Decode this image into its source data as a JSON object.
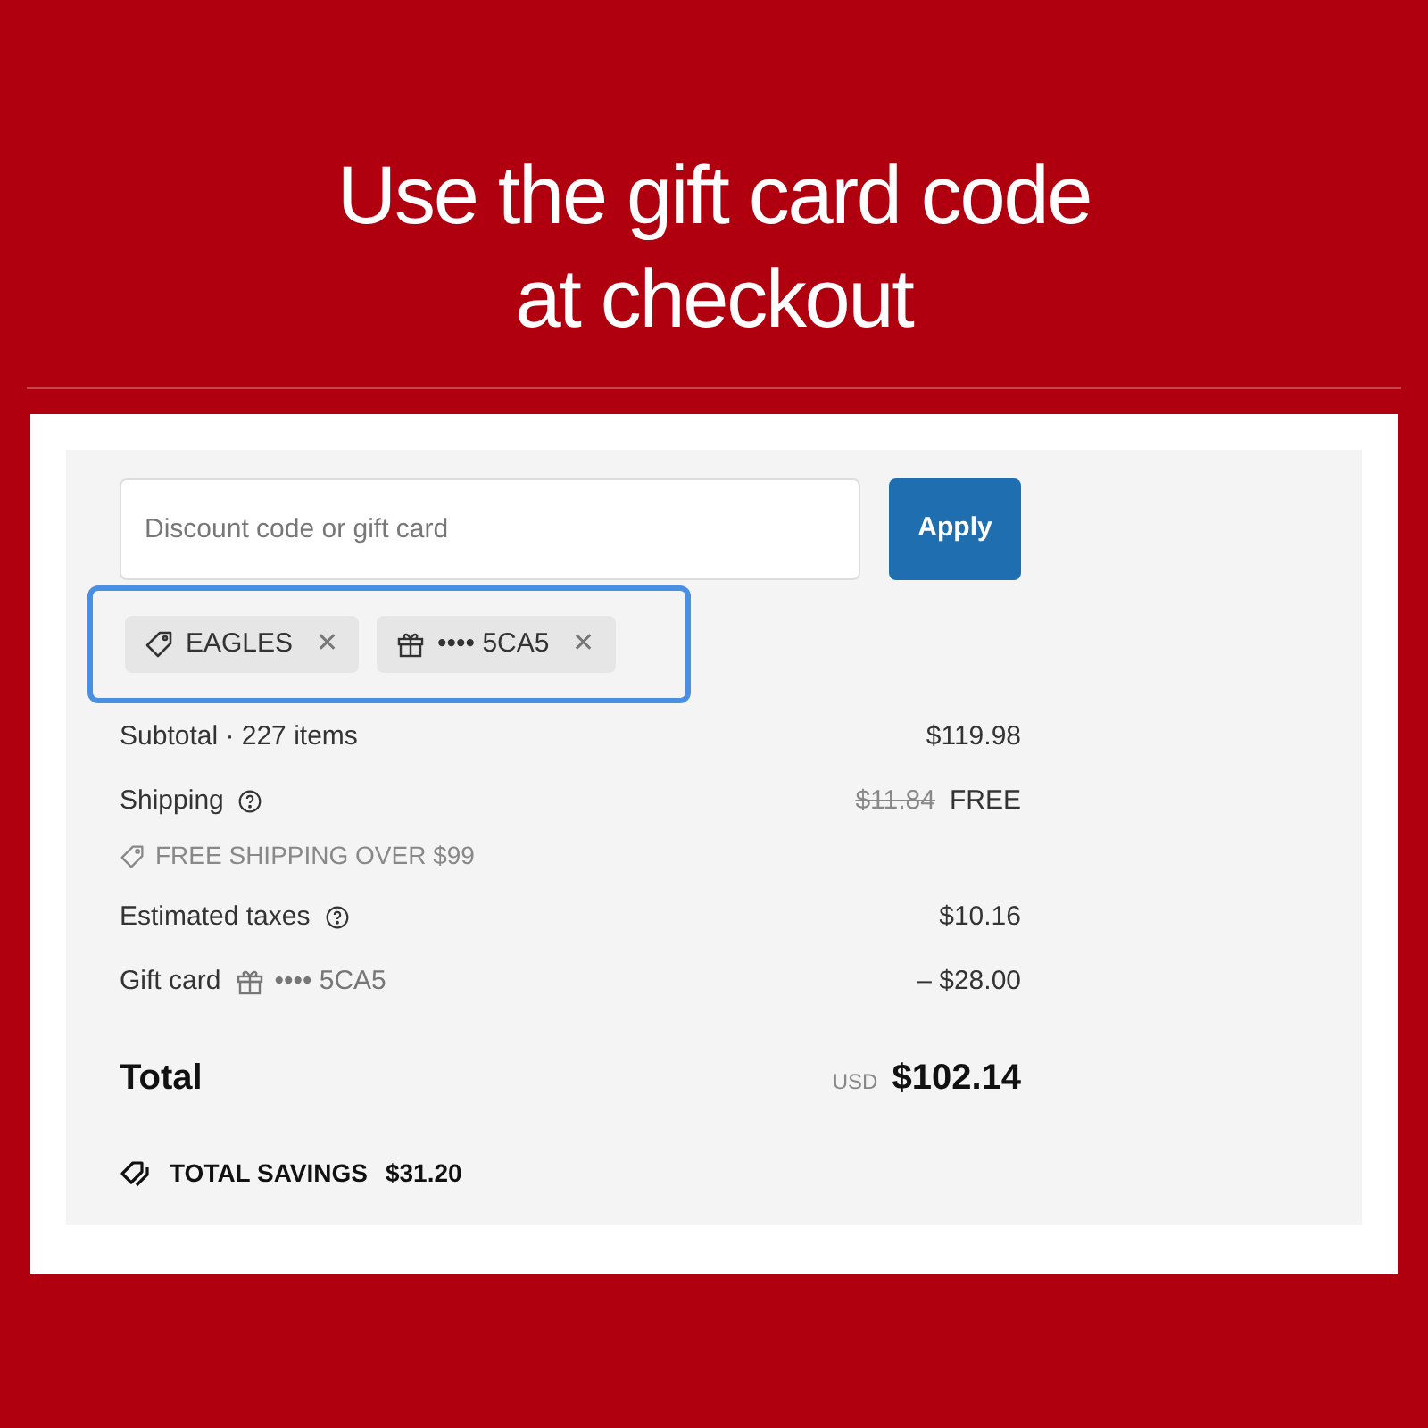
{
  "headline": [
    "Use the gift card code",
    "at checkout"
  ],
  "code_field": {
    "placeholder": "Discount code or gift card"
  },
  "apply_button": "Apply",
  "applied_codes": {
    "highlighted": true,
    "chips": [
      {
        "kind": "discount",
        "label": "EAGLES",
        "remove": "✕"
      },
      {
        "kind": "gift_card",
        "label": "•••• 5CA5",
        "remove": "✕"
      }
    ]
  },
  "summary_rows": [
    {
      "label": "Subtotal · 227 items",
      "value": "$119.98"
    },
    {
      "label": "Shipping",
      "help": true,
      "original_value": "$11.84",
      "value": "FREE",
      "note": "FREE SHIPPING OVER $99"
    },
    {
      "label": "Estimated taxes",
      "help": true,
      "value": "$10.16"
    },
    {
      "label": "Gift card",
      "code": "•••• 5CA5",
      "value": "– $28.00"
    }
  ],
  "total": {
    "label": "Total",
    "currency": "USD",
    "amount": "$102.14"
  },
  "savings": {
    "label": "TOTAL SAVINGS",
    "amount": "$31.20"
  }
}
